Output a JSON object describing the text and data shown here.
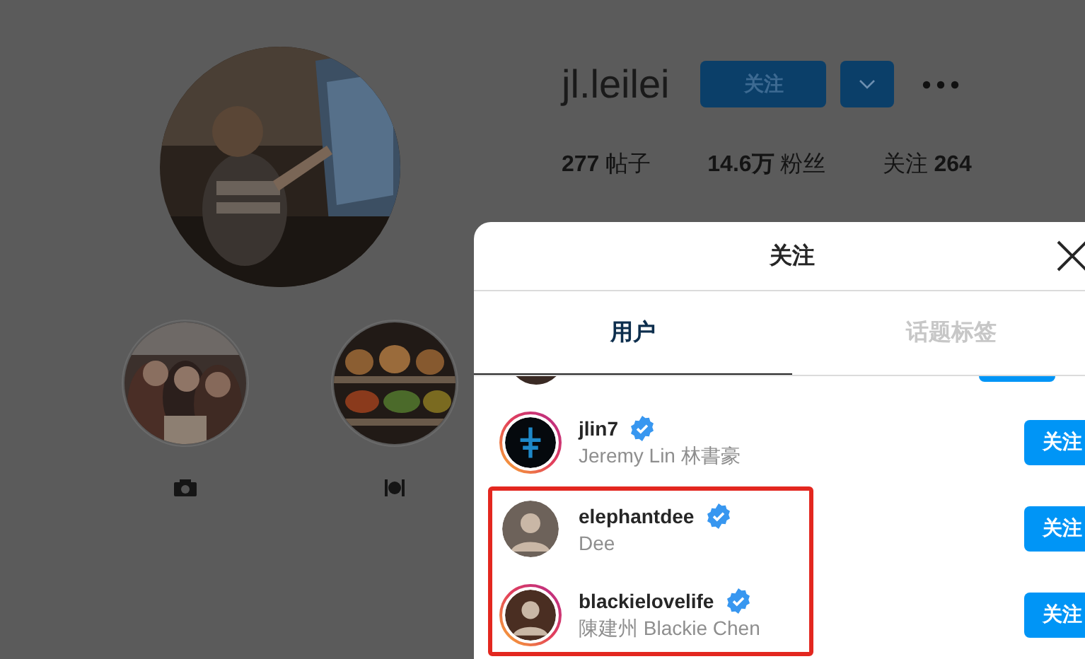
{
  "profile": {
    "username": "jl.leilei",
    "follow_button": "关注",
    "stats": [
      "**277** 帖子",
      "**14.6万** 粉丝",
      "关注 **264**"
    ],
    "highlights": [
      {
        "kind": "camera"
      },
      {
        "kind": "dining"
      }
    ]
  },
  "modal": {
    "title": "关注",
    "tabs": [
      {
        "label": "用户",
        "selected": true
      },
      {
        "label": "话题标签",
        "selected": false
      }
    ],
    "users": [
      {
        "username": "jlin7",
        "name": "Jeremy Lin 林書豪",
        "verified": true,
        "story": true,
        "button": "关注",
        "highlighted": false
      },
      {
        "username": "elephantdee",
        "name": "Dee",
        "verified": true,
        "story": false,
        "button": "关注",
        "highlighted": true
      },
      {
        "username": "blackielovelife",
        "name": "陳建州 Blackie Chen",
        "verified": true,
        "story": true,
        "button": "关注",
        "highlighted": true
      }
    ]
  }
}
